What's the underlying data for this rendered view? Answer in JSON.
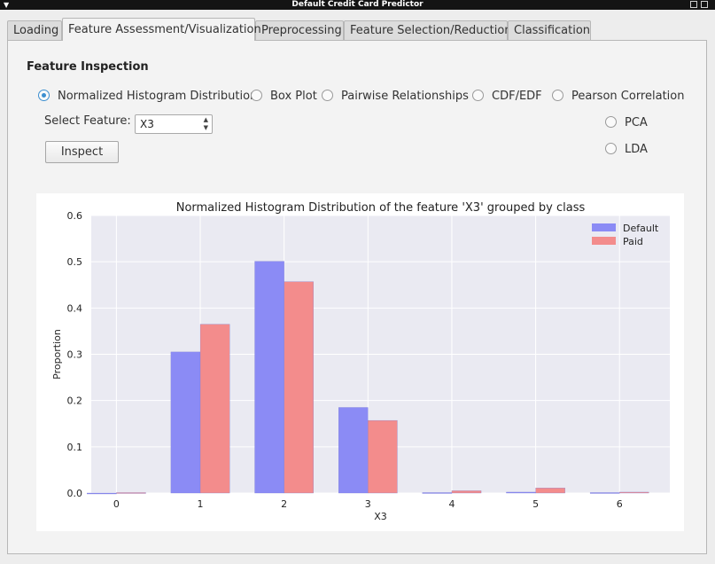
{
  "window": {
    "title": "Default Credit Card Predictor",
    "menu_icon": "chevron-down-icon",
    "buttons": [
      "minimize-icon",
      "maximize-icon",
      "close-icon"
    ]
  },
  "tabs": [
    {
      "label": "Loading",
      "active": false
    },
    {
      "label": "Feature Assessment/Visualization",
      "active": true
    },
    {
      "label": "Preprocessing",
      "active": false
    },
    {
      "label": "Feature Selection/Reduction",
      "active": false
    },
    {
      "label": "Classification",
      "active": false
    }
  ],
  "section_title": "Feature Inspection",
  "options": {
    "histogram": "Normalized Histogram Distribution",
    "boxplot": "Box Plot",
    "pairwise": "Pairwise Relationships",
    "cdf": "CDF/EDF",
    "pearson": "Pearson Correlation",
    "pca": "PCA",
    "lda": "LDA",
    "selected": "histogram"
  },
  "select_feature": {
    "label": "Select Feature:",
    "value": "X3"
  },
  "inspect_button": "Inspect",
  "colors": {
    "default": "#8b8bf5",
    "paid": "#f38c8c",
    "accent": "#3d8fd0",
    "plot_bg": "#eaeaf2"
  },
  "chart_data": {
    "type": "bar",
    "title": "Normalized Histogram Distribution of the feature 'X3' grouped by class",
    "xlabel": "X3",
    "ylabel": "Proportion",
    "categories": [
      "0",
      "1",
      "2",
      "3",
      "4",
      "5",
      "6"
    ],
    "x_ticks": [
      "0",
      "1",
      "2",
      "3",
      "4",
      "5",
      "6"
    ],
    "y_ticks": [
      "0.0",
      "0.1",
      "0.2",
      "0.3",
      "0.4",
      "0.5",
      "0.6"
    ],
    "ylim": [
      0,
      0.6
    ],
    "xlim": [
      -0.3,
      6.6
    ],
    "grid": true,
    "legend_position": "top-right",
    "series": [
      {
        "name": "Default",
        "color": "#8b8bf5",
        "values": [
          0.0,
          0.305,
          0.501,
          0.185,
          0.001,
          0.002,
          0.001
        ]
      },
      {
        "name": "Paid",
        "color": "#f38c8c",
        "values": [
          0.001,
          0.365,
          0.457,
          0.157,
          0.005,
          0.011,
          0.002
        ]
      }
    ]
  }
}
